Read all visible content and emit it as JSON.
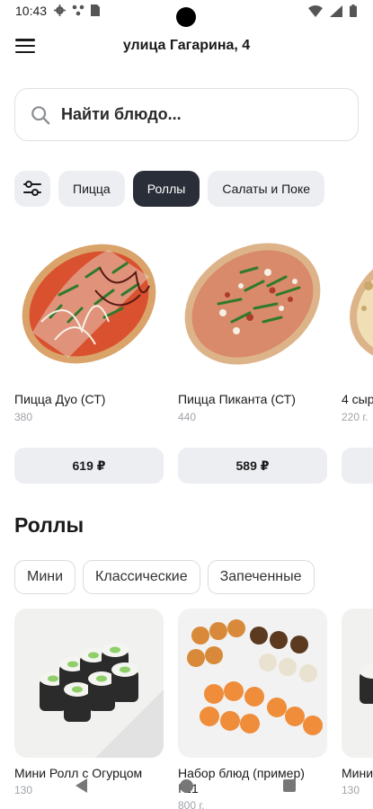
{
  "status_bar": {
    "time": "10:43"
  },
  "header": {
    "address": "улица Гагарина, 4"
  },
  "search": {
    "placeholder": "Найти блюдо..."
  },
  "categories": [
    {
      "label": "Пицца",
      "active": false
    },
    {
      "label": "Роллы",
      "active": true
    },
    {
      "label": "Салаты и Поке",
      "active": false
    }
  ],
  "pizzas": [
    {
      "name": "Пицца Дуо (СТ)",
      "weight": "380",
      "price": "619 ₽"
    },
    {
      "name": "Пицца Пиканта (СТ)",
      "weight": "440",
      "price": "589 ₽"
    },
    {
      "name": "4 сыр",
      "weight": "220 г.",
      "price": ""
    }
  ],
  "rolls_section": {
    "title": "Роллы",
    "subcategories": [
      "Мини",
      "Классические",
      "Запеченные"
    ],
    "items": [
      {
        "name": "Мини Ролл с Огурцом",
        "weight": "130"
      },
      {
        "name": "Набор блюд (пример) №1",
        "weight": "800 г."
      },
      {
        "name": "Мини",
        "weight": "130"
      }
    ]
  },
  "colors": {
    "active_chip": "#2a2e38",
    "chip_bg": "#eceef2",
    "muted_text": "#a0a3a8"
  }
}
